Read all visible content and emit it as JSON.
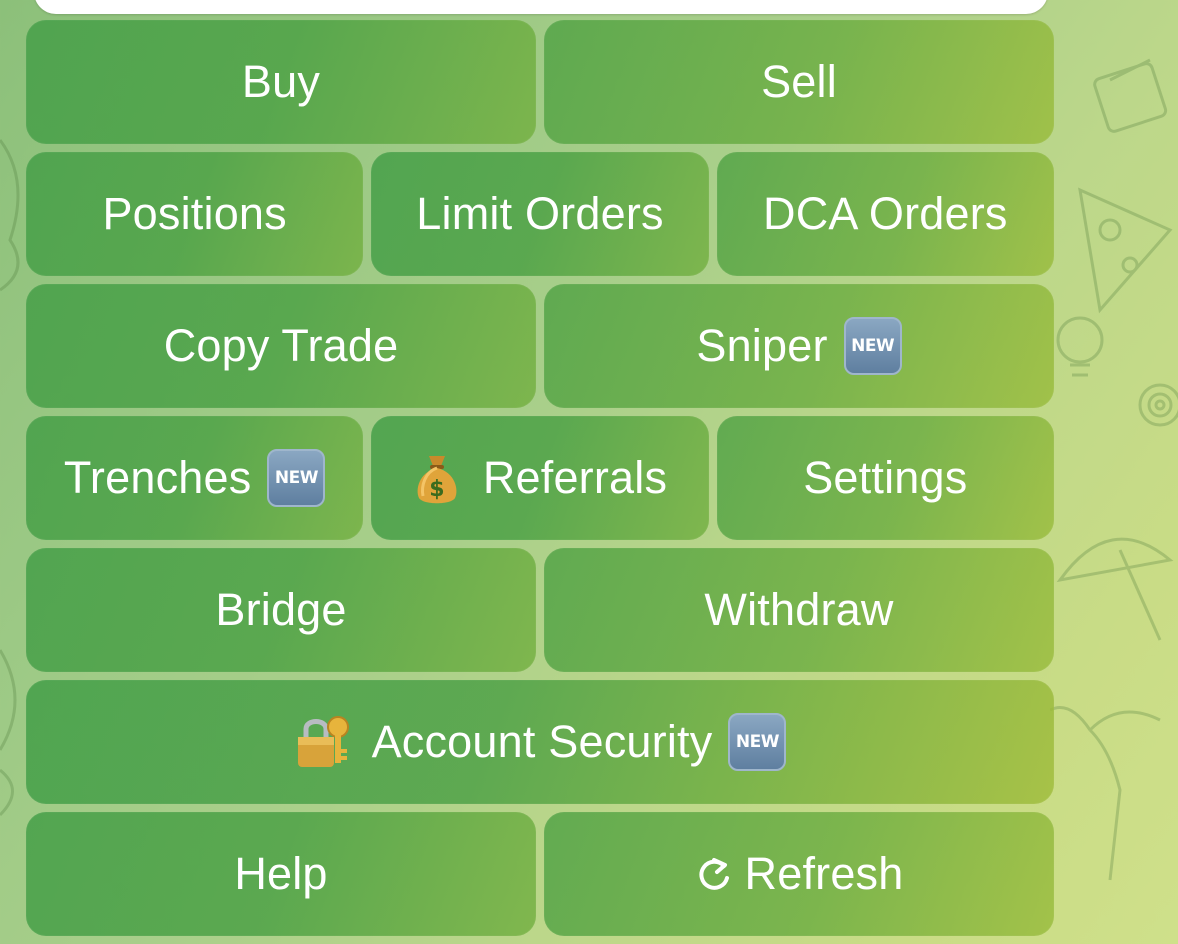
{
  "keyboard": {
    "rows": [
      [
        {
          "label": "Buy"
        },
        {
          "label": "Sell"
        }
      ],
      [
        {
          "label": "Positions"
        },
        {
          "label": "Limit Orders"
        },
        {
          "label": "DCA Orders"
        }
      ],
      [
        {
          "label": "Copy Trade"
        },
        {
          "label": "Sniper",
          "badge": "NEW"
        }
      ],
      [
        {
          "label": "Trenches",
          "badge": "NEW"
        },
        {
          "label": "Referrals",
          "icon": "money-bag-icon"
        },
        {
          "label": "Settings"
        }
      ],
      [
        {
          "label": "Bridge"
        },
        {
          "label": "Withdraw"
        }
      ],
      [
        {
          "label": "Account Security",
          "icon": "lock-with-key-icon",
          "badge": "NEW"
        }
      ],
      [
        {
          "label": "Help"
        },
        {
          "label": "Refresh",
          "icon": "refresh-icon"
        }
      ]
    ]
  },
  "colors": {
    "button_green": "#4ea44a",
    "button_yellow_green": "#9abc3c",
    "badge_blue": "#6f8fb0",
    "text": "#ffffff"
  }
}
